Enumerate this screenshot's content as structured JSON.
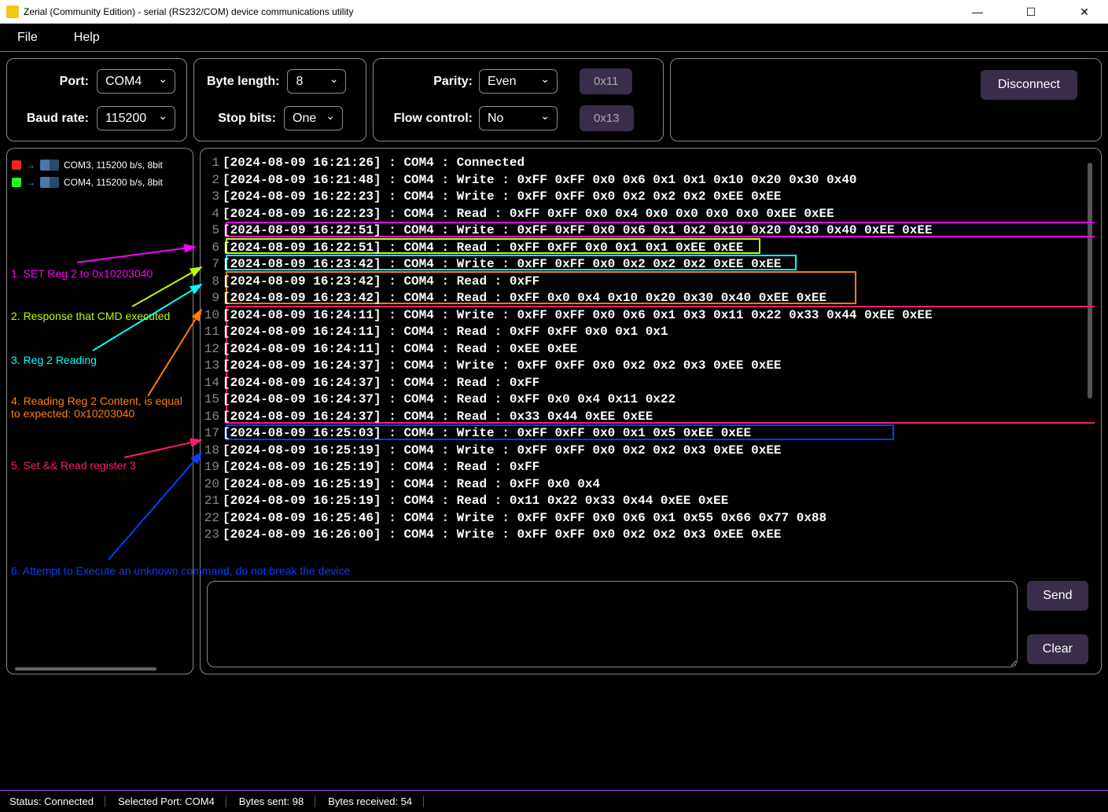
{
  "window": {
    "title": "Zerial (Community Edition) - serial (RS232/COM) device communications utility"
  },
  "menu": {
    "file": "File",
    "help": "Help"
  },
  "config": {
    "port_label": "Port:",
    "port_value": "COM4",
    "baud_label": "Baud rate:",
    "baud_value": "115200",
    "byte_label": "Byte length:",
    "byte_value": "8",
    "stop_label": "Stop bits:",
    "stop_value": "One",
    "parity_label": "Parity:",
    "parity_value": "Even",
    "flow_label": "Flow control:",
    "flow_value": "No",
    "hex1": "0x11",
    "hex2": "0x13",
    "disconnect": "Disconnect"
  },
  "ports": [
    {
      "led": "red",
      "label": "COM3, 115200 b/s, 8bit"
    },
    {
      "led": "green",
      "label": "COM4, 115200 b/s, 8bit"
    }
  ],
  "log": [
    "[2024-08-09 16:21:26] : COM4 : Connected",
    "[2024-08-09 16:21:48] : COM4 : Write : 0xFF 0xFF 0x0 0x6 0x1 0x1 0x10 0x20 0x30 0x40",
    "[2024-08-09 16:22:23] : COM4 : Write : 0xFF 0xFF 0x0 0x2 0x2 0x2 0xEE 0xEE",
    "[2024-08-09 16:22:23] : COM4 : Read : 0xFF 0xFF 0x0 0x4 0x0 0x0 0x0 0x0 0xEE 0xEE",
    "[2024-08-09 16:22:51] : COM4 : Write : 0xFF 0xFF 0x0 0x6 0x1 0x2 0x10 0x20 0x30 0x40 0xEE 0xEE",
    "[2024-08-09 16:22:51] : COM4 : Read : 0xFF 0xFF 0x0 0x1 0x1 0xEE 0xEE",
    "[2024-08-09 16:23:42] : COM4 : Write : 0xFF 0xFF 0x0 0x2 0x2 0x2 0xEE 0xEE",
    "[2024-08-09 16:23:42] : COM4 : Read : 0xFF",
    "[2024-08-09 16:23:42] : COM4 : Read : 0xFF 0x0 0x4 0x10 0x20 0x30 0x40 0xEE 0xEE",
    "[2024-08-09 16:24:11] : COM4 : Write : 0xFF 0xFF 0x0 0x6 0x1 0x3 0x11 0x22 0x33 0x44 0xEE 0xEE",
    "[2024-08-09 16:24:11] : COM4 : Read : 0xFF 0xFF 0x0 0x1 0x1",
    "[2024-08-09 16:24:11] : COM4 : Read : 0xEE 0xEE",
    "[2024-08-09 16:24:37] : COM4 : Write : 0xFF 0xFF 0x0 0x2 0x2 0x3 0xEE 0xEE",
    "[2024-08-09 16:24:37] : COM4 : Read : 0xFF",
    "[2024-08-09 16:24:37] : COM4 : Read : 0xFF 0x0 0x4 0x11 0x22",
    "[2024-08-09 16:24:37] : COM4 : Read : 0x33 0x44 0xEE 0xEE",
    "[2024-08-09 16:25:03] : COM4 : Write : 0xFF 0xFF 0x0 0x1 0x5 0xEE 0xEE",
    "[2024-08-09 16:25:19] : COM4 : Write : 0xFF 0xFF 0x0 0x2 0x2 0x3 0xEE 0xEE",
    "[2024-08-09 16:25:19] : COM4 : Read : 0xFF",
    "[2024-08-09 16:25:19] : COM4 : Read : 0xFF 0x0 0x4",
    "[2024-08-09 16:25:19] : COM4 : Read : 0x11 0x22 0x33 0x44 0xEE 0xEE",
    "[2024-08-09 16:25:46] : COM4 : Write : 0xFF 0xFF 0x0 0x6 0x1 0x55 0x66 0x77 0x88",
    "[2024-08-09 16:26:00] : COM4 : Write : 0xFF 0xFF 0x0 0x2 0x2 0x3 0xEE 0xEE"
  ],
  "buttons": {
    "send": "Send",
    "clear": "Clear"
  },
  "status": {
    "s1": "Status: Connected",
    "s2": "Selected Port: COM4",
    "s3": "Bytes sent: 98",
    "s4": "Bytes received: 54"
  },
  "annotations": {
    "a1": "1. SET Reg 2 to 0x10203040",
    "a2": "2. Response that CMD executed",
    "a3": "3. Reg 2 Reading",
    "a4": "4. Reading Reg 2 Content, is equal to expected: 0x10203040",
    "a5": "5. Set && Read register 3",
    "a6": "6. Attempt to Execute an unknown command, do not break the device"
  }
}
